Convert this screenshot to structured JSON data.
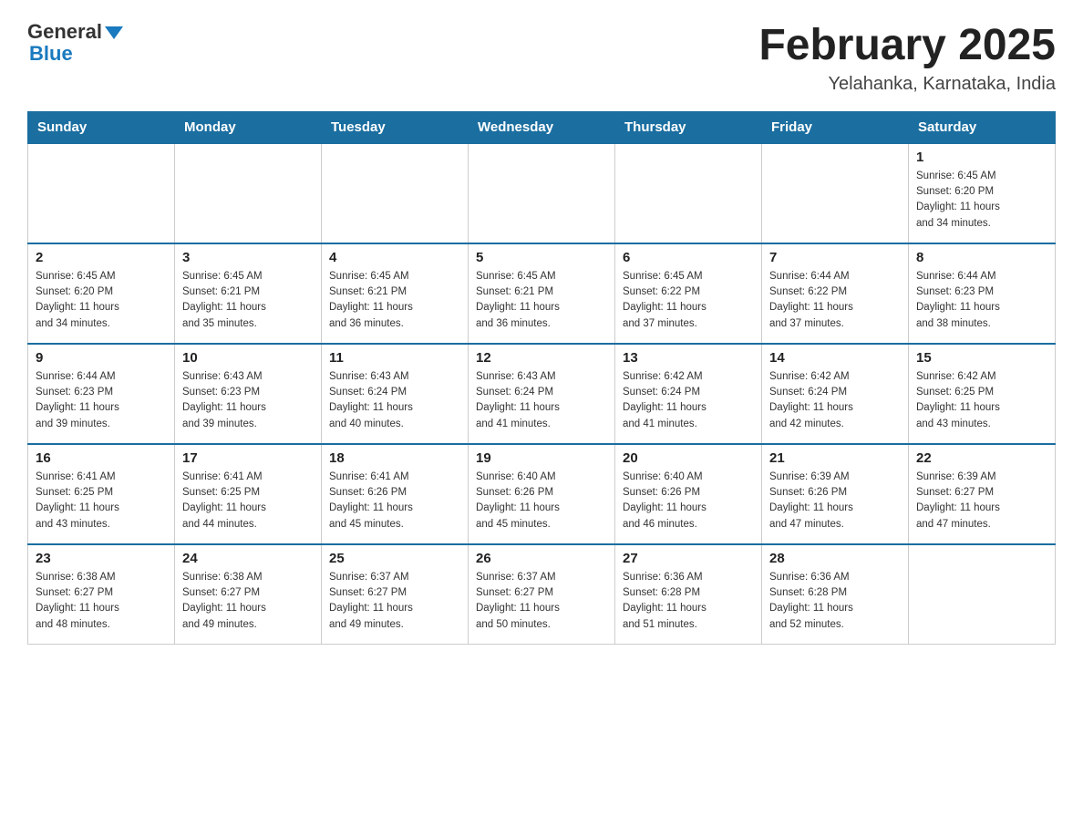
{
  "logo": {
    "general": "General",
    "blue": "Blue"
  },
  "header": {
    "title": "February 2025",
    "subtitle": "Yelahanka, Karnataka, India"
  },
  "weekdays": [
    "Sunday",
    "Monday",
    "Tuesday",
    "Wednesday",
    "Thursday",
    "Friday",
    "Saturday"
  ],
  "weeks": [
    [
      {
        "day": "",
        "info": ""
      },
      {
        "day": "",
        "info": ""
      },
      {
        "day": "",
        "info": ""
      },
      {
        "day": "",
        "info": ""
      },
      {
        "day": "",
        "info": ""
      },
      {
        "day": "",
        "info": ""
      },
      {
        "day": "1",
        "info": "Sunrise: 6:45 AM\nSunset: 6:20 PM\nDaylight: 11 hours\nand 34 minutes."
      }
    ],
    [
      {
        "day": "2",
        "info": "Sunrise: 6:45 AM\nSunset: 6:20 PM\nDaylight: 11 hours\nand 34 minutes."
      },
      {
        "day": "3",
        "info": "Sunrise: 6:45 AM\nSunset: 6:21 PM\nDaylight: 11 hours\nand 35 minutes."
      },
      {
        "day": "4",
        "info": "Sunrise: 6:45 AM\nSunset: 6:21 PM\nDaylight: 11 hours\nand 36 minutes."
      },
      {
        "day": "5",
        "info": "Sunrise: 6:45 AM\nSunset: 6:21 PM\nDaylight: 11 hours\nand 36 minutes."
      },
      {
        "day": "6",
        "info": "Sunrise: 6:45 AM\nSunset: 6:22 PM\nDaylight: 11 hours\nand 37 minutes."
      },
      {
        "day": "7",
        "info": "Sunrise: 6:44 AM\nSunset: 6:22 PM\nDaylight: 11 hours\nand 37 minutes."
      },
      {
        "day": "8",
        "info": "Sunrise: 6:44 AM\nSunset: 6:23 PM\nDaylight: 11 hours\nand 38 minutes."
      }
    ],
    [
      {
        "day": "9",
        "info": "Sunrise: 6:44 AM\nSunset: 6:23 PM\nDaylight: 11 hours\nand 39 minutes."
      },
      {
        "day": "10",
        "info": "Sunrise: 6:43 AM\nSunset: 6:23 PM\nDaylight: 11 hours\nand 39 minutes."
      },
      {
        "day": "11",
        "info": "Sunrise: 6:43 AM\nSunset: 6:24 PM\nDaylight: 11 hours\nand 40 minutes."
      },
      {
        "day": "12",
        "info": "Sunrise: 6:43 AM\nSunset: 6:24 PM\nDaylight: 11 hours\nand 41 minutes."
      },
      {
        "day": "13",
        "info": "Sunrise: 6:42 AM\nSunset: 6:24 PM\nDaylight: 11 hours\nand 41 minutes."
      },
      {
        "day": "14",
        "info": "Sunrise: 6:42 AM\nSunset: 6:24 PM\nDaylight: 11 hours\nand 42 minutes."
      },
      {
        "day": "15",
        "info": "Sunrise: 6:42 AM\nSunset: 6:25 PM\nDaylight: 11 hours\nand 43 minutes."
      }
    ],
    [
      {
        "day": "16",
        "info": "Sunrise: 6:41 AM\nSunset: 6:25 PM\nDaylight: 11 hours\nand 43 minutes."
      },
      {
        "day": "17",
        "info": "Sunrise: 6:41 AM\nSunset: 6:25 PM\nDaylight: 11 hours\nand 44 minutes."
      },
      {
        "day": "18",
        "info": "Sunrise: 6:41 AM\nSunset: 6:26 PM\nDaylight: 11 hours\nand 45 minutes."
      },
      {
        "day": "19",
        "info": "Sunrise: 6:40 AM\nSunset: 6:26 PM\nDaylight: 11 hours\nand 45 minutes."
      },
      {
        "day": "20",
        "info": "Sunrise: 6:40 AM\nSunset: 6:26 PM\nDaylight: 11 hours\nand 46 minutes."
      },
      {
        "day": "21",
        "info": "Sunrise: 6:39 AM\nSunset: 6:26 PM\nDaylight: 11 hours\nand 47 minutes."
      },
      {
        "day": "22",
        "info": "Sunrise: 6:39 AM\nSunset: 6:27 PM\nDaylight: 11 hours\nand 47 minutes."
      }
    ],
    [
      {
        "day": "23",
        "info": "Sunrise: 6:38 AM\nSunset: 6:27 PM\nDaylight: 11 hours\nand 48 minutes."
      },
      {
        "day": "24",
        "info": "Sunrise: 6:38 AM\nSunset: 6:27 PM\nDaylight: 11 hours\nand 49 minutes."
      },
      {
        "day": "25",
        "info": "Sunrise: 6:37 AM\nSunset: 6:27 PM\nDaylight: 11 hours\nand 49 minutes."
      },
      {
        "day": "26",
        "info": "Sunrise: 6:37 AM\nSunset: 6:27 PM\nDaylight: 11 hours\nand 50 minutes."
      },
      {
        "day": "27",
        "info": "Sunrise: 6:36 AM\nSunset: 6:28 PM\nDaylight: 11 hours\nand 51 minutes."
      },
      {
        "day": "28",
        "info": "Sunrise: 6:36 AM\nSunset: 6:28 PM\nDaylight: 11 hours\nand 52 minutes."
      },
      {
        "day": "",
        "info": ""
      }
    ]
  ]
}
